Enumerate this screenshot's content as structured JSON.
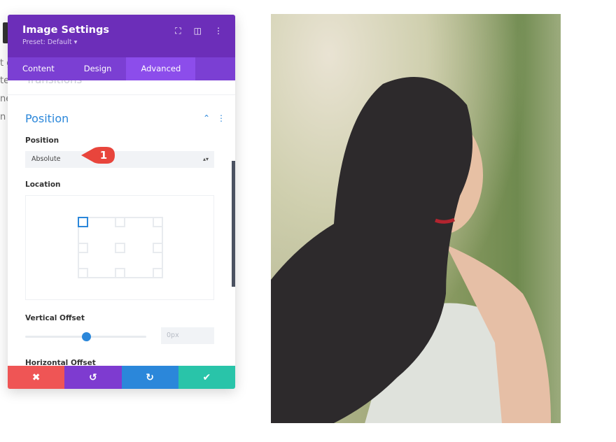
{
  "background_text": [
    "t g",
    "te",
    "ne",
    "n t"
  ],
  "panel": {
    "title": "Image Settings",
    "preset": "Preset: Default ▾",
    "header_icons": [
      "fullscreen-icon",
      "split-view-icon",
      "more-vertical-icon"
    ],
    "tabs": [
      {
        "label": "Content"
      },
      {
        "label": "Design"
      },
      {
        "label": "Advanced",
        "active": true
      }
    ],
    "ghost_section": "Transitions",
    "section": {
      "title": "Position",
      "collapse_icon": "chevron-up-icon"
    },
    "position": {
      "label": "Position",
      "value": "Absolute",
      "badge": "1"
    },
    "location": {
      "label": "Location",
      "selected": "top-left"
    },
    "vertical_offset": {
      "label": "Vertical Offset",
      "value": "0px",
      "slider_percent": 50
    },
    "horizontal_offset": {
      "label": "Horizontal Offset"
    },
    "footer": [
      {
        "name": "cancel",
        "icon": "✖",
        "color": "#ef5555"
      },
      {
        "name": "undo",
        "icon": "↺",
        "color": "#7e3bd0"
      },
      {
        "name": "redo",
        "icon": "↻",
        "color": "#2b87da"
      },
      {
        "name": "save",
        "icon": "✔",
        "color": "#29c4a9"
      }
    ]
  },
  "colors": {
    "header": "#6c2eb9",
    "accent": "#2b87da"
  }
}
